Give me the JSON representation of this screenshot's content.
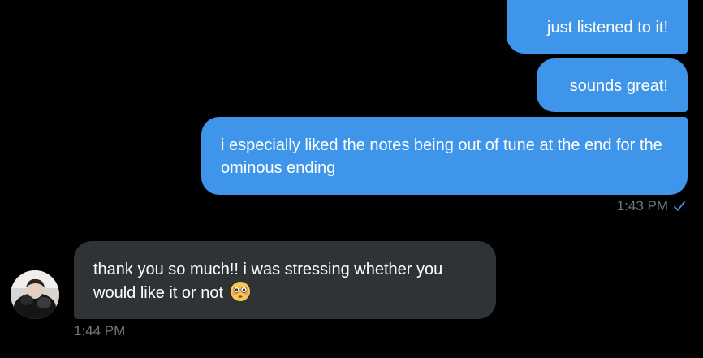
{
  "conversation": {
    "sent_messages": [
      {
        "text": "just listened to it!"
      },
      {
        "text": "sounds great!"
      },
      {
        "text": "i especially liked the notes being out of tune at the end for the ominous ending"
      }
    ],
    "sent_timestamp": "1:43 PM",
    "received_messages": [
      {
        "text": "thank you so much!! i was stressing whether you would like it or not",
        "emoji": "flushed-face"
      }
    ],
    "received_timestamp": "1:44 PM"
  },
  "colors": {
    "background": "#000000",
    "sent_bubble": "#3e95e9",
    "received_bubble": "#2f3336",
    "timestamp": "#71767b",
    "read_check": "#3e95e9"
  },
  "icons": {
    "read_receipt": "checkmark-icon",
    "emoji": "flushed-face-icon"
  }
}
